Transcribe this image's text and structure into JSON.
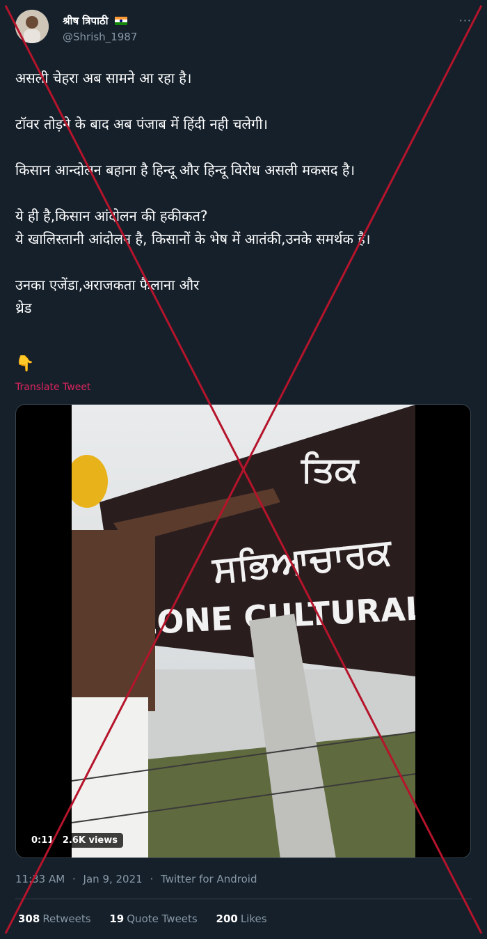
{
  "author": {
    "name": "श्रीष त्रिपाठी",
    "handle": "@Shrish_1987",
    "verified_flag": "india-flag-icon"
  },
  "more_menu": "···",
  "tweet_text": "असली चेहरा अब सामने आ रहा है।\n\nटॉवर तोड़ने के बाद अब पंजाब में हिंदी नही चलेगी।\n\nकिसान आन्दोलन बहाना है हिन्दू और हिन्दू विरोध असली मकसद है।\n\nये ही है,किसान आंदोलन की हकीकत?\nये खालिस्तानी आंदोलन है, किसानों के भेष में आतंकी,उनके समर्थक है।\n\nउनका एजेंडा,अराजकता फैलाना और\nथ्रेड",
  "pointer_emoji": "👇",
  "translate_link": "Translate Tweet",
  "video": {
    "duration": "0:11",
    "views": "2.6K views",
    "sign_text_top": "ਤਿਕ",
    "sign_text_mid": "ਸਭਿਆਚਾਰਕ",
    "sign_text_bottom": "ZONE CULTURAL"
  },
  "meta": {
    "time": "11:33 AM",
    "date": "Jan 9, 2021",
    "source": "Twitter for Android"
  },
  "stats": {
    "retweets_count": "308",
    "retweets_label": "Retweets",
    "quotes_count": "19",
    "quotes_label": "Quote Tweets",
    "likes_count": "200",
    "likes_label": "Likes"
  },
  "colors": {
    "background": "#15202b",
    "muted": "#8899a6",
    "accent_pink": "#e0245e",
    "cross_mark": "#b5142b"
  }
}
